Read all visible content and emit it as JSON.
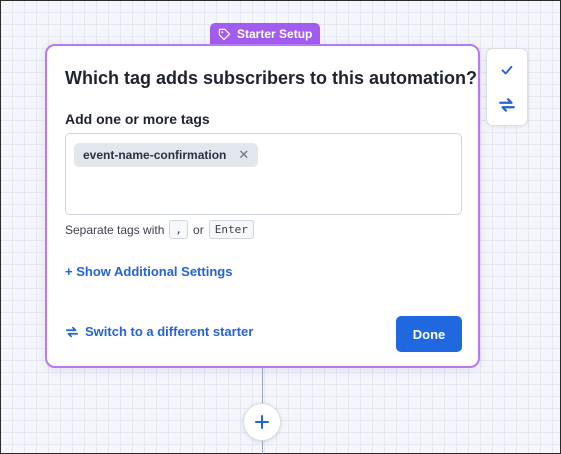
{
  "badge": {
    "label": "Starter Setup",
    "icon": "tag-icon"
  },
  "card": {
    "title": "Which tag adds subscribers to this automation?",
    "field_label": "Add one or more tags",
    "tags": [
      "event-name-confirmation"
    ],
    "hint_prefix": "Separate tags with",
    "hint_key_comma": ",",
    "hint_or": "or",
    "hint_key_enter": "Enter",
    "show_settings_label": "+ Show Additional Settings",
    "switch_label": "Switch to a different starter",
    "done_label": "Done"
  },
  "side_panel": {
    "items": [
      {
        "icon": "checkmark-icon"
      },
      {
        "icon": "swap-icon"
      }
    ]
  },
  "canvas": {
    "add_icon": "plus-icon"
  },
  "colors": {
    "accent_purple": "#b77af5",
    "badge_purple": "#a35cf0",
    "link_blue": "#2563d6",
    "button_blue": "#1f68e0"
  }
}
